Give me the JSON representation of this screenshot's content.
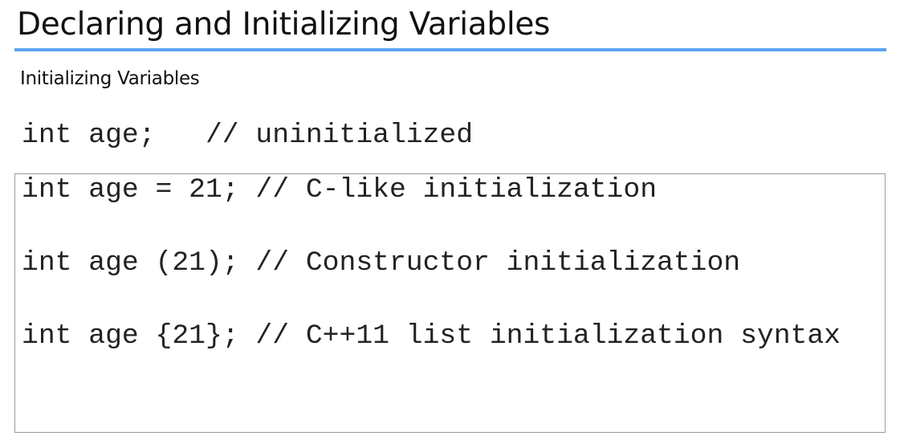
{
  "slide": {
    "title": "Declaring and Initializing Variables",
    "subtitle": "Initializing Variables",
    "uninitialized_line": "int age;   // uninitialized",
    "code_lines": [
      "int age = 21; // C-like initialization",
      "int age (21); // Constructor initialization",
      "int age {21}; // C++11 list initialization syntax"
    ],
    "accent_color": "#5aa5f0"
  }
}
